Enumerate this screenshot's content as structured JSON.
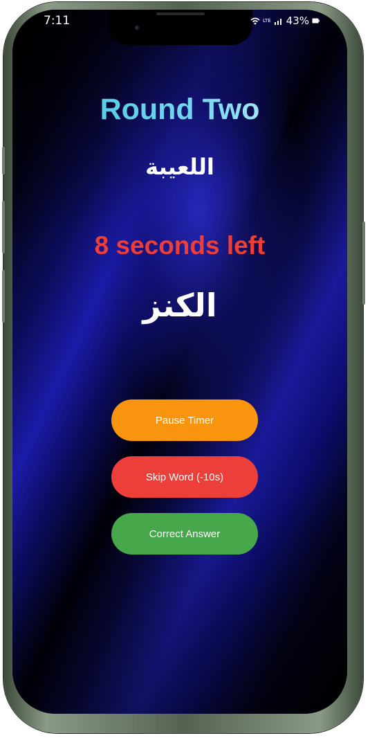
{
  "status_bar": {
    "time": "7:11",
    "network": "LTE",
    "signal": "▐▐",
    "battery": "43%"
  },
  "game": {
    "round_title": "Round Two",
    "player_name": "اللعيبة",
    "timer_text": "8 seconds left",
    "current_word": "الكنز"
  },
  "actions": {
    "pause_label": "Pause Timer",
    "skip_label": "Skip Word (-10s)",
    "correct_label": "Correct Answer"
  },
  "colors": {
    "title_gradient_start": "#3bc3e2",
    "timer": "#ee3e37",
    "pause_button": "#f8940d",
    "skip_button": "#ec3f3a",
    "correct_button": "#47a84b"
  }
}
